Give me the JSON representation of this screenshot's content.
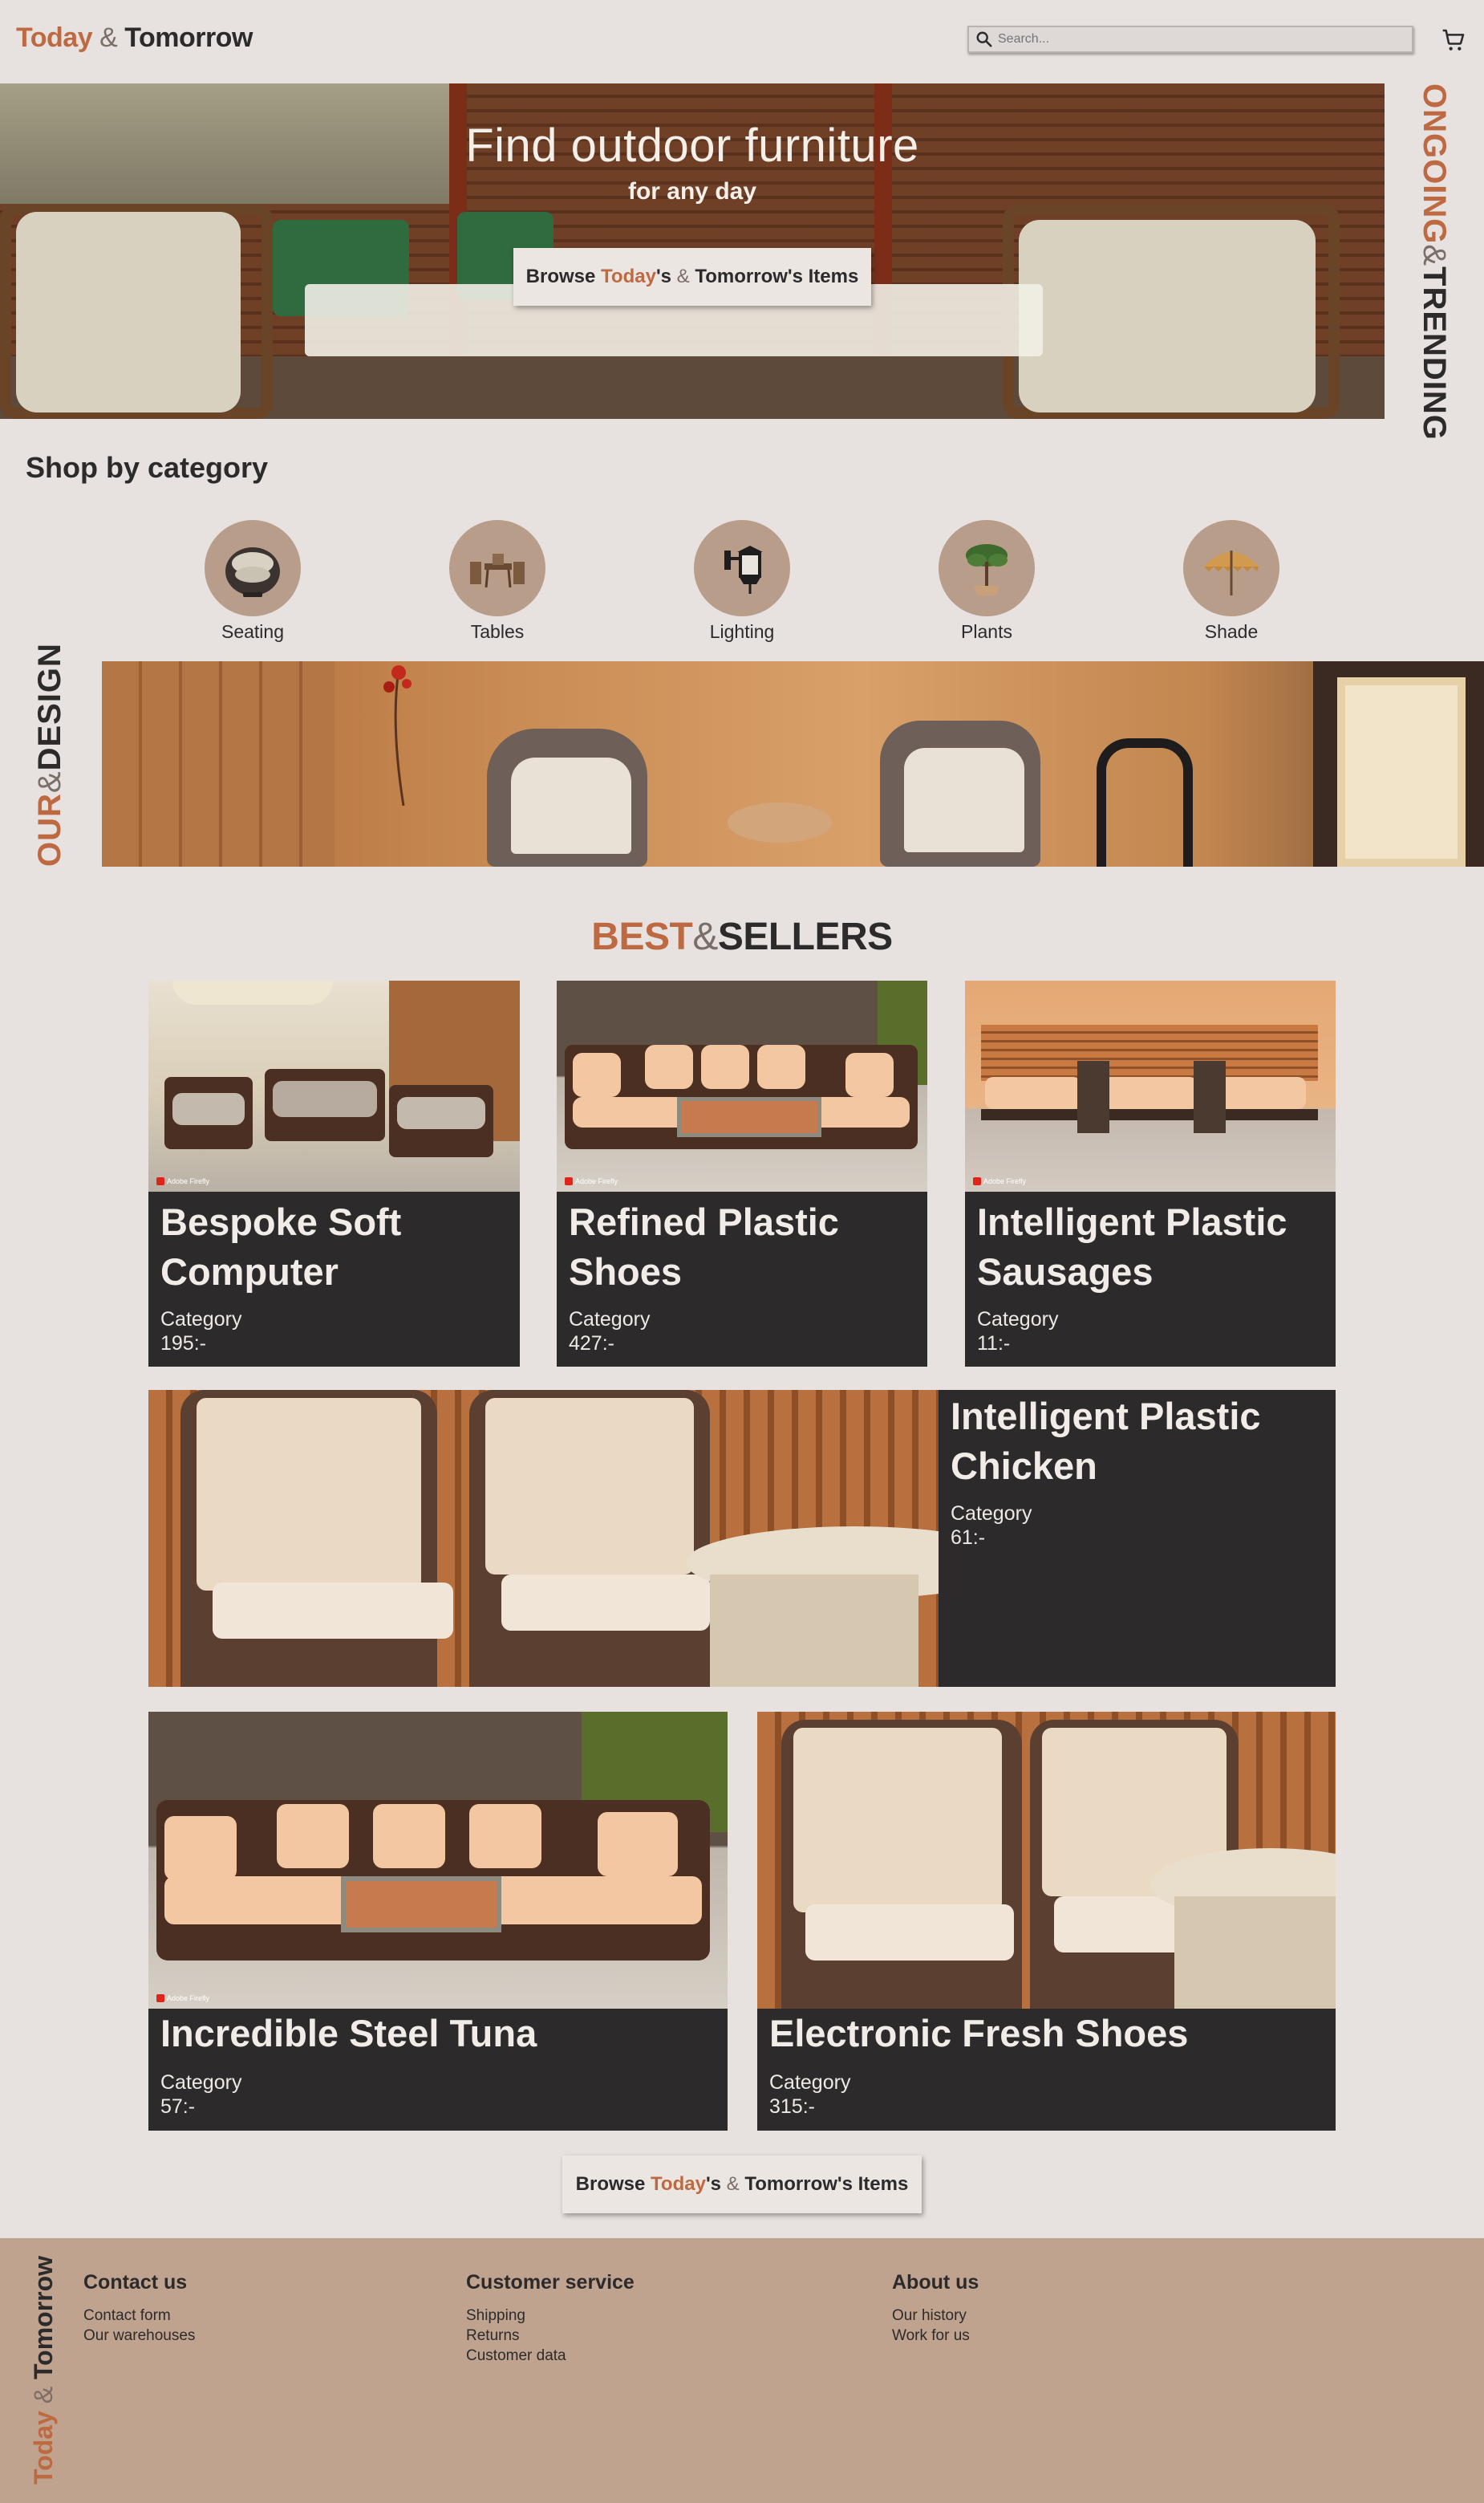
{
  "header": {
    "logo_today": "Today",
    "logo_amp": "&",
    "logo_tomorrow": "Tomorrow",
    "search_placeholder": "Search...",
    "search_icon": "search-icon",
    "cart_icon": "cart-icon"
  },
  "hero": {
    "title": "Find outdoor furniture",
    "subtitle": "for any day",
    "cta": {
      "prefix": "Browse ",
      "today": "Today",
      "mid": "'s ",
      "amp": "&",
      "suffix": " Tomorrow's Items"
    }
  },
  "trending_label": {
    "first": "ONGOING",
    "amp": "&",
    "second": "TRENDING"
  },
  "categories": {
    "title": "Shop by category",
    "items": [
      {
        "label": "Seating",
        "icon": "seating-icon"
      },
      {
        "label": "Tables",
        "icon": "tables-icon"
      },
      {
        "label": "Lighting",
        "icon": "lighting-icon"
      },
      {
        "label": "Plants",
        "icon": "plants-icon"
      },
      {
        "label": "Shade",
        "icon": "shade-icon"
      }
    ]
  },
  "design_label": {
    "first": "OUR",
    "amp": "&",
    "second": "DESIGN"
  },
  "bestsellers": {
    "title_first": "BEST",
    "title_amp": "&",
    "title_second": "SELLERS",
    "watermark": "Adobe Firefly",
    "products": [
      {
        "name": "Bespoke Soft Computer",
        "category": "Category",
        "price": "195:-"
      },
      {
        "name": "Refined Plastic Shoes",
        "category": "Category",
        "price": "427:-"
      },
      {
        "name": "Intelligent Plastic Sausages",
        "category": "Category",
        "price": "11:-"
      },
      {
        "name": "Intelligent Plastic Chicken",
        "category": "Category",
        "price": "61:-"
      },
      {
        "name": "Incredible Steel Tuna",
        "category": "Category",
        "price": "57:-"
      },
      {
        "name": "Electronic Fresh Shoes",
        "category": "Category",
        "price": "315:-"
      }
    ],
    "cta": {
      "prefix": "Browse ",
      "today": "Today",
      "mid": "'s ",
      "amp": "&",
      "suffix": " Tomorrow's Items"
    }
  },
  "footer": {
    "logo_today": "Today",
    "logo_amp": "&",
    "logo_tomorrow": "Tomorrow",
    "columns": [
      {
        "title": "Contact us",
        "links": [
          "Contact form",
          "Our warehouses"
        ]
      },
      {
        "title": "Customer service",
        "links": [
          "Shipping",
          "Returns",
          "Customer data"
        ]
      },
      {
        "title": "About us",
        "links": [
          "Our history",
          "Work for us"
        ]
      }
    ]
  },
  "colors": {
    "accent": "#bd6a43",
    "dark": "#2c2a2b",
    "background": "#e7e1df",
    "footer": "#bfa38f",
    "category_circle": "#b79d8a"
  }
}
